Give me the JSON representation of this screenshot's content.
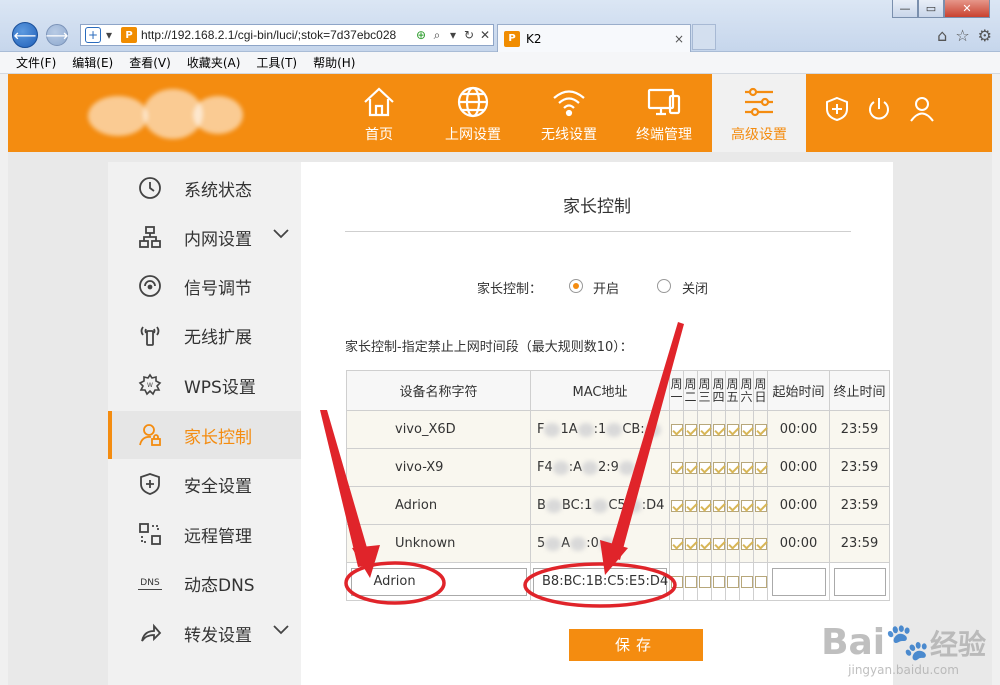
{
  "browser": {
    "url": "http://192.168.2.1/cgi-bin/luci/;stok=7d37ebc028",
    "tab_title": "K2",
    "tab_close": "×",
    "favicon_letter": "P",
    "menu": [
      "文件(F)",
      "编辑(E)",
      "查看(V)",
      "收藏夹(A)",
      "工具(T)",
      "帮助(H)"
    ]
  },
  "header": {
    "nav": [
      {
        "label": "首页",
        "icon": "home-icon"
      },
      {
        "label": "上网设置",
        "icon": "globe-icon"
      },
      {
        "label": "无线设置",
        "icon": "wifi-icon"
      },
      {
        "label": "终端管理",
        "icon": "devices-icon"
      },
      {
        "label": "高级设置",
        "icon": "sliders-icon",
        "active": true
      }
    ]
  },
  "sidebar": {
    "items": [
      {
        "label": "系统状态",
        "icon": "clock-icon"
      },
      {
        "label": "内网设置",
        "icon": "network-icon",
        "expandable": true
      },
      {
        "label": "信号调节",
        "icon": "signal-icon"
      },
      {
        "label": "无线扩展",
        "icon": "extender-icon"
      },
      {
        "label": "WPS设置",
        "icon": "wps-icon"
      },
      {
        "label": "家长控制",
        "icon": "parent-icon",
        "active": true
      },
      {
        "label": "安全设置",
        "icon": "shield-icon"
      },
      {
        "label": "远程管理",
        "icon": "remote-icon"
      },
      {
        "label": "动态DNS",
        "icon": "dns-icon"
      },
      {
        "label": "转发设置",
        "icon": "forward-icon",
        "expandable": true
      }
    ]
  },
  "content": {
    "title": "家长控制",
    "pc_label": "家长控制：",
    "opt_on": "开启",
    "opt_off": "关闭",
    "selected": "开启",
    "rule_desc": "家长控制-指定禁止上网时间段（最大规则数10）：",
    "columns": {
      "name": "设备名称字符",
      "mac": "MAC地址",
      "days": [
        "周一",
        "周二",
        "周三",
        "周四",
        "周五",
        "周六",
        "周日"
      ],
      "start": "起始时间",
      "end": "终止时间"
    },
    "rows": [
      {
        "name": "vivo_X6D",
        "mac": [
          "F",
          "1A",
          ":1",
          "CB:"
        ],
        "start": "00:00",
        "end": "23:59"
      },
      {
        "name": "vivo-X9",
        "mac": [
          "F4",
          ":A",
          "2:9",
          "6"
        ],
        "start": "00:00",
        "end": "23:59"
      },
      {
        "name": "Adrion",
        "mac": [
          "B",
          "BC:1",
          "C5",
          ":D4"
        ],
        "start": "00:00",
        "end": "23:59"
      },
      {
        "name": "Unknown",
        "mac": [
          "5",
          "A",
          ":0",
          "6"
        ],
        "start": "00:00",
        "end": "23:59"
      }
    ],
    "new_row": {
      "name": "Adrion",
      "mac": "B8:BC:1B:C5:E5:D4",
      "start": "",
      "end": ""
    },
    "save": "保存"
  },
  "colors": {
    "accent": "#f48c10",
    "annotation": "#e0242a"
  },
  "watermark": {
    "brand": "Bai",
    "brand_cn": "经验",
    "site": "jingyan.baidu.com"
  }
}
